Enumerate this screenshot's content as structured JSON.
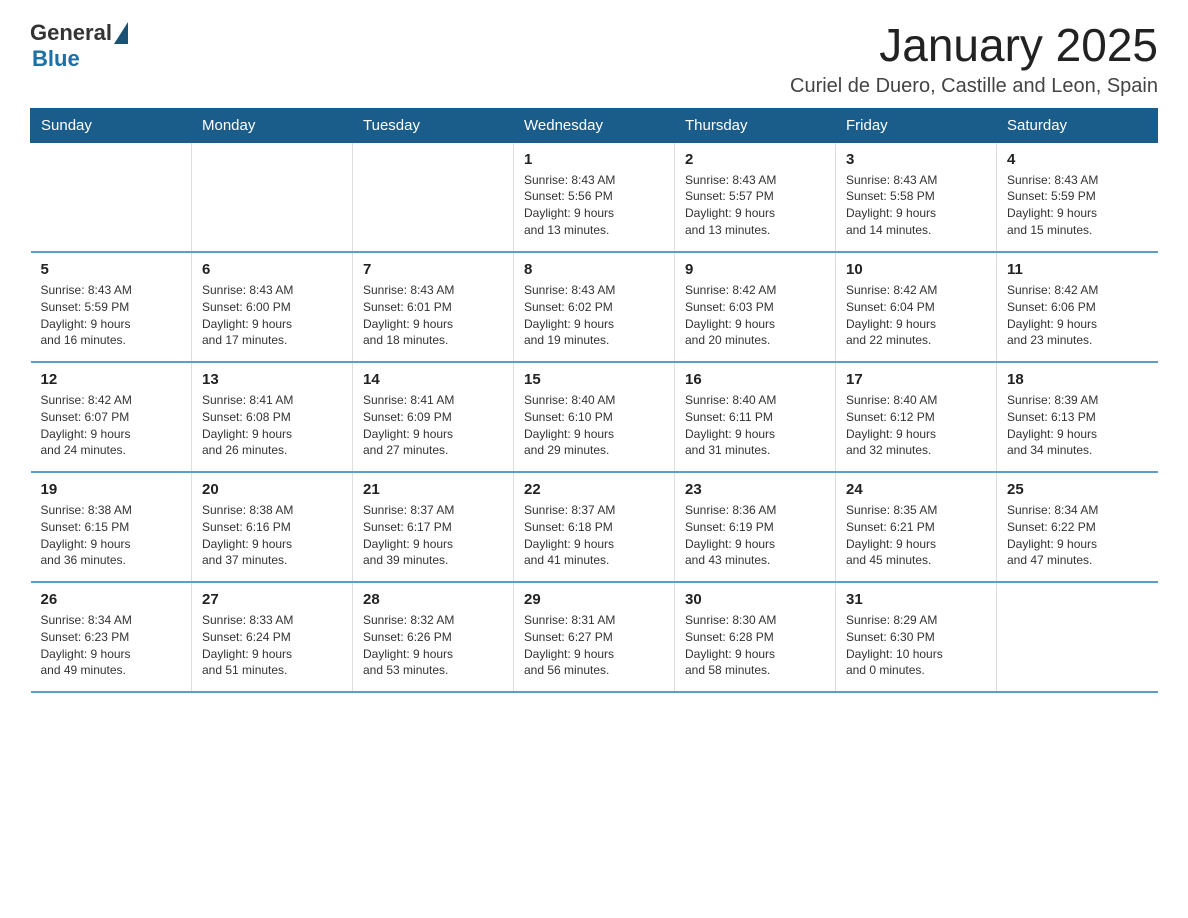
{
  "header": {
    "title": "January 2025",
    "subtitle": "Curiel de Duero, Castille and Leon, Spain",
    "logo_general": "General",
    "logo_blue": "Blue"
  },
  "calendar": {
    "days_of_week": [
      "Sunday",
      "Monday",
      "Tuesday",
      "Wednesday",
      "Thursday",
      "Friday",
      "Saturday"
    ],
    "weeks": [
      {
        "days": [
          {
            "number": "",
            "info": ""
          },
          {
            "number": "",
            "info": ""
          },
          {
            "number": "",
            "info": ""
          },
          {
            "number": "1",
            "info": "Sunrise: 8:43 AM\nSunset: 5:56 PM\nDaylight: 9 hours\nand 13 minutes."
          },
          {
            "number": "2",
            "info": "Sunrise: 8:43 AM\nSunset: 5:57 PM\nDaylight: 9 hours\nand 13 minutes."
          },
          {
            "number": "3",
            "info": "Sunrise: 8:43 AM\nSunset: 5:58 PM\nDaylight: 9 hours\nand 14 minutes."
          },
          {
            "number": "4",
            "info": "Sunrise: 8:43 AM\nSunset: 5:59 PM\nDaylight: 9 hours\nand 15 minutes."
          }
        ]
      },
      {
        "days": [
          {
            "number": "5",
            "info": "Sunrise: 8:43 AM\nSunset: 5:59 PM\nDaylight: 9 hours\nand 16 minutes."
          },
          {
            "number": "6",
            "info": "Sunrise: 8:43 AM\nSunset: 6:00 PM\nDaylight: 9 hours\nand 17 minutes."
          },
          {
            "number": "7",
            "info": "Sunrise: 8:43 AM\nSunset: 6:01 PM\nDaylight: 9 hours\nand 18 minutes."
          },
          {
            "number": "8",
            "info": "Sunrise: 8:43 AM\nSunset: 6:02 PM\nDaylight: 9 hours\nand 19 minutes."
          },
          {
            "number": "9",
            "info": "Sunrise: 8:42 AM\nSunset: 6:03 PM\nDaylight: 9 hours\nand 20 minutes."
          },
          {
            "number": "10",
            "info": "Sunrise: 8:42 AM\nSunset: 6:04 PM\nDaylight: 9 hours\nand 22 minutes."
          },
          {
            "number": "11",
            "info": "Sunrise: 8:42 AM\nSunset: 6:06 PM\nDaylight: 9 hours\nand 23 minutes."
          }
        ]
      },
      {
        "days": [
          {
            "number": "12",
            "info": "Sunrise: 8:42 AM\nSunset: 6:07 PM\nDaylight: 9 hours\nand 24 minutes."
          },
          {
            "number": "13",
            "info": "Sunrise: 8:41 AM\nSunset: 6:08 PM\nDaylight: 9 hours\nand 26 minutes."
          },
          {
            "number": "14",
            "info": "Sunrise: 8:41 AM\nSunset: 6:09 PM\nDaylight: 9 hours\nand 27 minutes."
          },
          {
            "number": "15",
            "info": "Sunrise: 8:40 AM\nSunset: 6:10 PM\nDaylight: 9 hours\nand 29 minutes."
          },
          {
            "number": "16",
            "info": "Sunrise: 8:40 AM\nSunset: 6:11 PM\nDaylight: 9 hours\nand 31 minutes."
          },
          {
            "number": "17",
            "info": "Sunrise: 8:40 AM\nSunset: 6:12 PM\nDaylight: 9 hours\nand 32 minutes."
          },
          {
            "number": "18",
            "info": "Sunrise: 8:39 AM\nSunset: 6:13 PM\nDaylight: 9 hours\nand 34 minutes."
          }
        ]
      },
      {
        "days": [
          {
            "number": "19",
            "info": "Sunrise: 8:38 AM\nSunset: 6:15 PM\nDaylight: 9 hours\nand 36 minutes."
          },
          {
            "number": "20",
            "info": "Sunrise: 8:38 AM\nSunset: 6:16 PM\nDaylight: 9 hours\nand 37 minutes."
          },
          {
            "number": "21",
            "info": "Sunrise: 8:37 AM\nSunset: 6:17 PM\nDaylight: 9 hours\nand 39 minutes."
          },
          {
            "number": "22",
            "info": "Sunrise: 8:37 AM\nSunset: 6:18 PM\nDaylight: 9 hours\nand 41 minutes."
          },
          {
            "number": "23",
            "info": "Sunrise: 8:36 AM\nSunset: 6:19 PM\nDaylight: 9 hours\nand 43 minutes."
          },
          {
            "number": "24",
            "info": "Sunrise: 8:35 AM\nSunset: 6:21 PM\nDaylight: 9 hours\nand 45 minutes."
          },
          {
            "number": "25",
            "info": "Sunrise: 8:34 AM\nSunset: 6:22 PM\nDaylight: 9 hours\nand 47 minutes."
          }
        ]
      },
      {
        "days": [
          {
            "number": "26",
            "info": "Sunrise: 8:34 AM\nSunset: 6:23 PM\nDaylight: 9 hours\nand 49 minutes."
          },
          {
            "number": "27",
            "info": "Sunrise: 8:33 AM\nSunset: 6:24 PM\nDaylight: 9 hours\nand 51 minutes."
          },
          {
            "number": "28",
            "info": "Sunrise: 8:32 AM\nSunset: 6:26 PM\nDaylight: 9 hours\nand 53 minutes."
          },
          {
            "number": "29",
            "info": "Sunrise: 8:31 AM\nSunset: 6:27 PM\nDaylight: 9 hours\nand 56 minutes."
          },
          {
            "number": "30",
            "info": "Sunrise: 8:30 AM\nSunset: 6:28 PM\nDaylight: 9 hours\nand 58 minutes."
          },
          {
            "number": "31",
            "info": "Sunrise: 8:29 AM\nSunset: 6:30 PM\nDaylight: 10 hours\nand 0 minutes."
          },
          {
            "number": "",
            "info": ""
          }
        ]
      }
    ]
  }
}
